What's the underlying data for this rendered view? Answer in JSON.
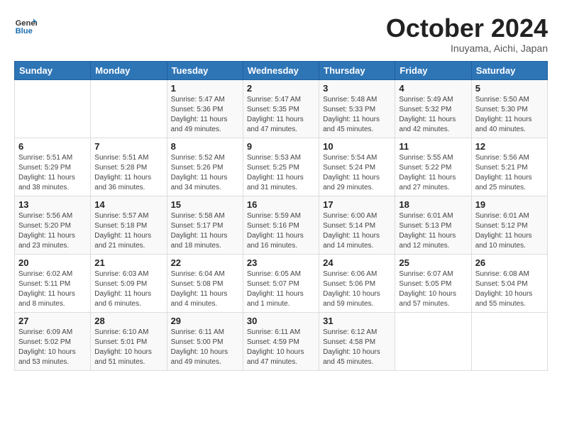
{
  "header": {
    "logo_line1": "General",
    "logo_line2": "Blue",
    "month_year": "October 2024",
    "location": "Inuyama, Aichi, Japan"
  },
  "weekdays": [
    "Sunday",
    "Monday",
    "Tuesday",
    "Wednesday",
    "Thursday",
    "Friday",
    "Saturday"
  ],
  "weeks": [
    [
      {
        "day": "",
        "sunrise": "",
        "sunset": "",
        "daylight": ""
      },
      {
        "day": "",
        "sunrise": "",
        "sunset": "",
        "daylight": ""
      },
      {
        "day": "1",
        "sunrise": "Sunrise: 5:47 AM",
        "sunset": "Sunset: 5:36 PM",
        "daylight": "Daylight: 11 hours and 49 minutes."
      },
      {
        "day": "2",
        "sunrise": "Sunrise: 5:47 AM",
        "sunset": "Sunset: 5:35 PM",
        "daylight": "Daylight: 11 hours and 47 minutes."
      },
      {
        "day": "3",
        "sunrise": "Sunrise: 5:48 AM",
        "sunset": "Sunset: 5:33 PM",
        "daylight": "Daylight: 11 hours and 45 minutes."
      },
      {
        "day": "4",
        "sunrise": "Sunrise: 5:49 AM",
        "sunset": "Sunset: 5:32 PM",
        "daylight": "Daylight: 11 hours and 42 minutes."
      },
      {
        "day": "5",
        "sunrise": "Sunrise: 5:50 AM",
        "sunset": "Sunset: 5:30 PM",
        "daylight": "Daylight: 11 hours and 40 minutes."
      }
    ],
    [
      {
        "day": "6",
        "sunrise": "Sunrise: 5:51 AM",
        "sunset": "Sunset: 5:29 PM",
        "daylight": "Daylight: 11 hours and 38 minutes."
      },
      {
        "day": "7",
        "sunrise": "Sunrise: 5:51 AM",
        "sunset": "Sunset: 5:28 PM",
        "daylight": "Daylight: 11 hours and 36 minutes."
      },
      {
        "day": "8",
        "sunrise": "Sunrise: 5:52 AM",
        "sunset": "Sunset: 5:26 PM",
        "daylight": "Daylight: 11 hours and 34 minutes."
      },
      {
        "day": "9",
        "sunrise": "Sunrise: 5:53 AM",
        "sunset": "Sunset: 5:25 PM",
        "daylight": "Daylight: 11 hours and 31 minutes."
      },
      {
        "day": "10",
        "sunrise": "Sunrise: 5:54 AM",
        "sunset": "Sunset: 5:24 PM",
        "daylight": "Daylight: 11 hours and 29 minutes."
      },
      {
        "day": "11",
        "sunrise": "Sunrise: 5:55 AM",
        "sunset": "Sunset: 5:22 PM",
        "daylight": "Daylight: 11 hours and 27 minutes."
      },
      {
        "day": "12",
        "sunrise": "Sunrise: 5:56 AM",
        "sunset": "Sunset: 5:21 PM",
        "daylight": "Daylight: 11 hours and 25 minutes."
      }
    ],
    [
      {
        "day": "13",
        "sunrise": "Sunrise: 5:56 AM",
        "sunset": "Sunset: 5:20 PM",
        "daylight": "Daylight: 11 hours and 23 minutes."
      },
      {
        "day": "14",
        "sunrise": "Sunrise: 5:57 AM",
        "sunset": "Sunset: 5:18 PM",
        "daylight": "Daylight: 11 hours and 21 minutes."
      },
      {
        "day": "15",
        "sunrise": "Sunrise: 5:58 AM",
        "sunset": "Sunset: 5:17 PM",
        "daylight": "Daylight: 11 hours and 18 minutes."
      },
      {
        "day": "16",
        "sunrise": "Sunrise: 5:59 AM",
        "sunset": "Sunset: 5:16 PM",
        "daylight": "Daylight: 11 hours and 16 minutes."
      },
      {
        "day": "17",
        "sunrise": "Sunrise: 6:00 AM",
        "sunset": "Sunset: 5:14 PM",
        "daylight": "Daylight: 11 hours and 14 minutes."
      },
      {
        "day": "18",
        "sunrise": "Sunrise: 6:01 AM",
        "sunset": "Sunset: 5:13 PM",
        "daylight": "Daylight: 11 hours and 12 minutes."
      },
      {
        "day": "19",
        "sunrise": "Sunrise: 6:01 AM",
        "sunset": "Sunset: 5:12 PM",
        "daylight": "Daylight: 11 hours and 10 minutes."
      }
    ],
    [
      {
        "day": "20",
        "sunrise": "Sunrise: 6:02 AM",
        "sunset": "Sunset: 5:11 PM",
        "daylight": "Daylight: 11 hours and 8 minutes."
      },
      {
        "day": "21",
        "sunrise": "Sunrise: 6:03 AM",
        "sunset": "Sunset: 5:09 PM",
        "daylight": "Daylight: 11 hours and 6 minutes."
      },
      {
        "day": "22",
        "sunrise": "Sunrise: 6:04 AM",
        "sunset": "Sunset: 5:08 PM",
        "daylight": "Daylight: 11 hours and 4 minutes."
      },
      {
        "day": "23",
        "sunrise": "Sunrise: 6:05 AM",
        "sunset": "Sunset: 5:07 PM",
        "daylight": "Daylight: 11 hours and 1 minute."
      },
      {
        "day": "24",
        "sunrise": "Sunrise: 6:06 AM",
        "sunset": "Sunset: 5:06 PM",
        "daylight": "Daylight: 10 hours and 59 minutes."
      },
      {
        "day": "25",
        "sunrise": "Sunrise: 6:07 AM",
        "sunset": "Sunset: 5:05 PM",
        "daylight": "Daylight: 10 hours and 57 minutes."
      },
      {
        "day": "26",
        "sunrise": "Sunrise: 6:08 AM",
        "sunset": "Sunset: 5:04 PM",
        "daylight": "Daylight: 10 hours and 55 minutes."
      }
    ],
    [
      {
        "day": "27",
        "sunrise": "Sunrise: 6:09 AM",
        "sunset": "Sunset: 5:02 PM",
        "daylight": "Daylight: 10 hours and 53 minutes."
      },
      {
        "day": "28",
        "sunrise": "Sunrise: 6:10 AM",
        "sunset": "Sunset: 5:01 PM",
        "daylight": "Daylight: 10 hours and 51 minutes."
      },
      {
        "day": "29",
        "sunrise": "Sunrise: 6:11 AM",
        "sunset": "Sunset: 5:00 PM",
        "daylight": "Daylight: 10 hours and 49 minutes."
      },
      {
        "day": "30",
        "sunrise": "Sunrise: 6:11 AM",
        "sunset": "Sunset: 4:59 PM",
        "daylight": "Daylight: 10 hours and 47 minutes."
      },
      {
        "day": "31",
        "sunrise": "Sunrise: 6:12 AM",
        "sunset": "Sunset: 4:58 PM",
        "daylight": "Daylight: 10 hours and 45 minutes."
      },
      {
        "day": "",
        "sunrise": "",
        "sunset": "",
        "daylight": ""
      },
      {
        "day": "",
        "sunrise": "",
        "sunset": "",
        "daylight": ""
      }
    ]
  ]
}
